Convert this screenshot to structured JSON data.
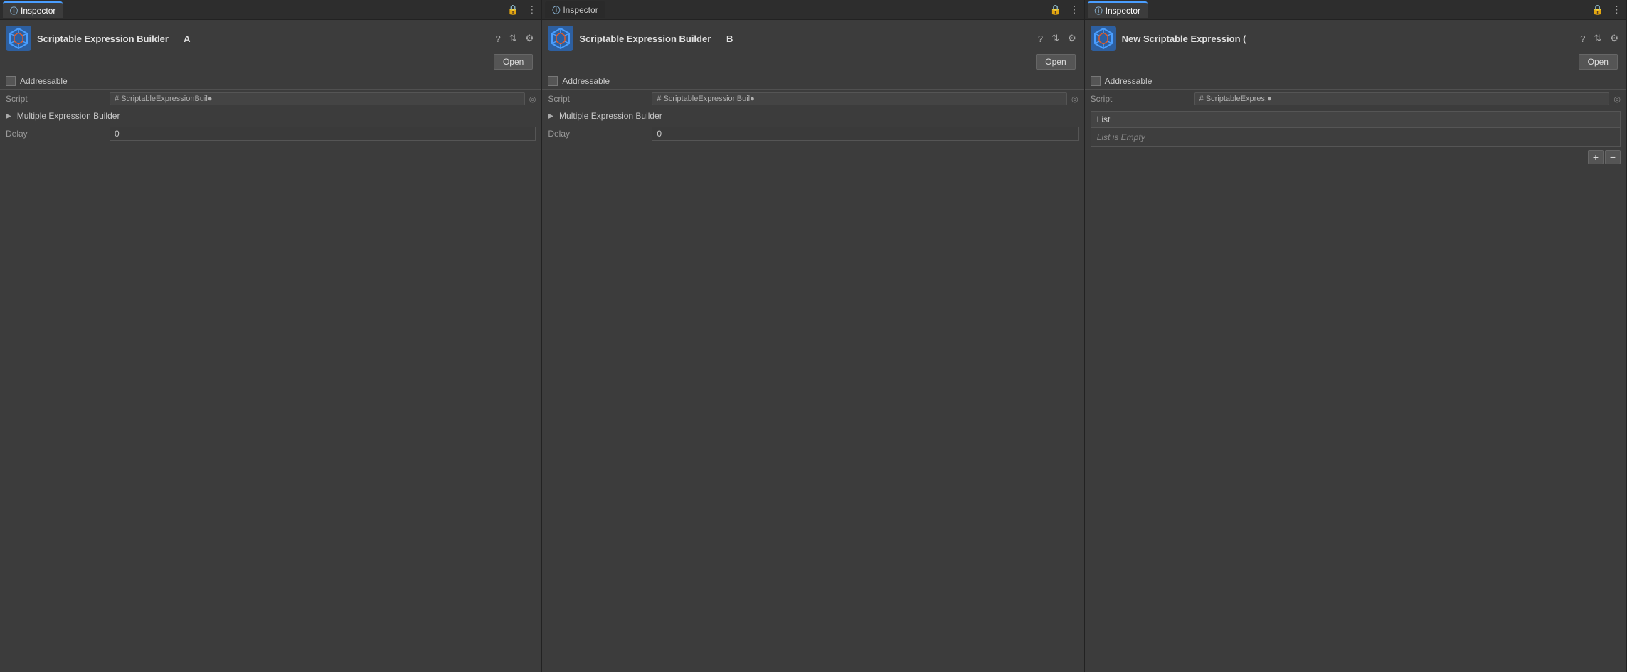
{
  "panels": [
    {
      "id": "panel-a",
      "tab_label": "Inspector",
      "tab_active": true,
      "asset_title": "Scriptable Expression Builder __ A",
      "has_open_btn": true,
      "open_btn_label": "Open",
      "addressable_label": "Addressable",
      "script_label": "Script",
      "script_ref": "ScriptableExpressionBuil●",
      "multiple_expression_label": "Multiple Expression Builder",
      "delay_label": "Delay",
      "delay_value": "0",
      "has_list": false
    },
    {
      "id": "panel-b",
      "tab_label": "Inspector",
      "tab_active": false,
      "asset_title": "Scriptable Expression Builder __ B",
      "has_open_btn": true,
      "open_btn_label": "Open",
      "addressable_label": "Addressable",
      "script_label": "Script",
      "script_ref": "ScriptableExpressionBuil●",
      "multiple_expression_label": "Multiple Expression Builder",
      "delay_label": "Delay",
      "delay_value": "0",
      "has_list": false
    },
    {
      "id": "panel-c",
      "tab_label": "Inspector",
      "tab_active": true,
      "asset_title": "New Scriptable Expression (",
      "has_open_btn": true,
      "open_btn_label": "Open",
      "addressable_label": "Addressable",
      "script_label": "Script",
      "script_ref": "ScriptableExpres:●",
      "multiple_expression_label": null,
      "delay_label": null,
      "delay_value": null,
      "has_list": true,
      "list_header": "List",
      "list_empty_text": "List is Empty",
      "add_btn_label": "+",
      "remove_btn_label": "−"
    }
  ],
  "icons": {
    "lock": "🔒",
    "menu": "⋮",
    "help": "?",
    "tools": "⇅",
    "settings": "⚙"
  }
}
